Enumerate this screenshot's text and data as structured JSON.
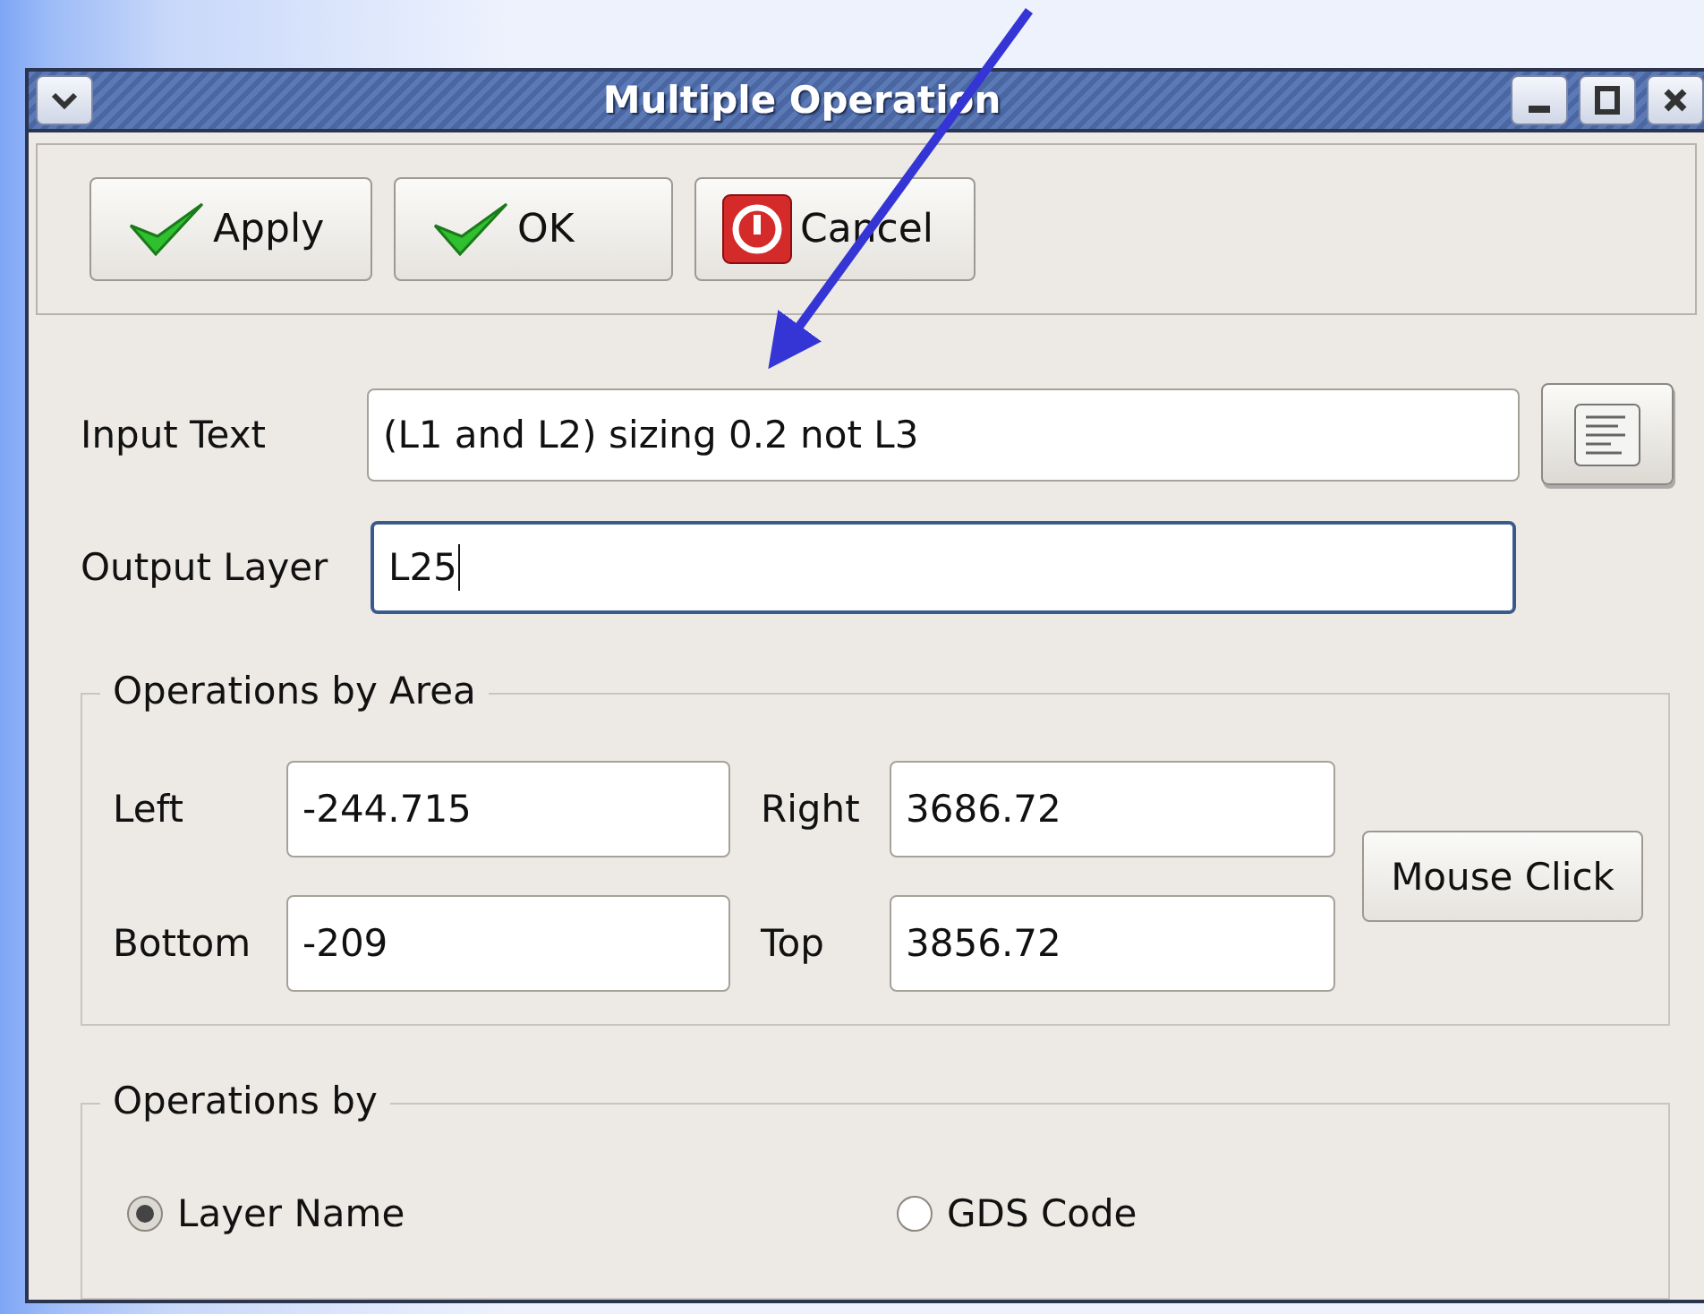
{
  "window": {
    "title": "Multiple Operation"
  },
  "toolbar": [
    {
      "label": "Apply",
      "kind": "check"
    },
    {
      "label": "OK",
      "kind": "check"
    },
    {
      "label": "Cancel",
      "kind": "stop"
    }
  ],
  "input_text": {
    "label": "Input Text",
    "value": "(L1 and L2) sizing 0.2 not L3"
  },
  "output_layer": {
    "label": "Output Layer",
    "value": "L25",
    "focused": true
  },
  "area_group": {
    "title": "Operations by Area",
    "button": "Mouse Click",
    "fields": [
      {
        "label": "Left",
        "value": "-244.715"
      },
      {
        "label": "Right",
        "value": "3686.72"
      },
      {
        "label": "Bottom",
        "value": "-209"
      },
      {
        "label": "Top",
        "value": "3856.72"
      }
    ]
  },
  "mode_group": {
    "title": "Operations by",
    "options": [
      {
        "label": "Layer Name",
        "selected": true
      },
      {
        "label": "GDS Code",
        "selected": false
      }
    ]
  }
}
